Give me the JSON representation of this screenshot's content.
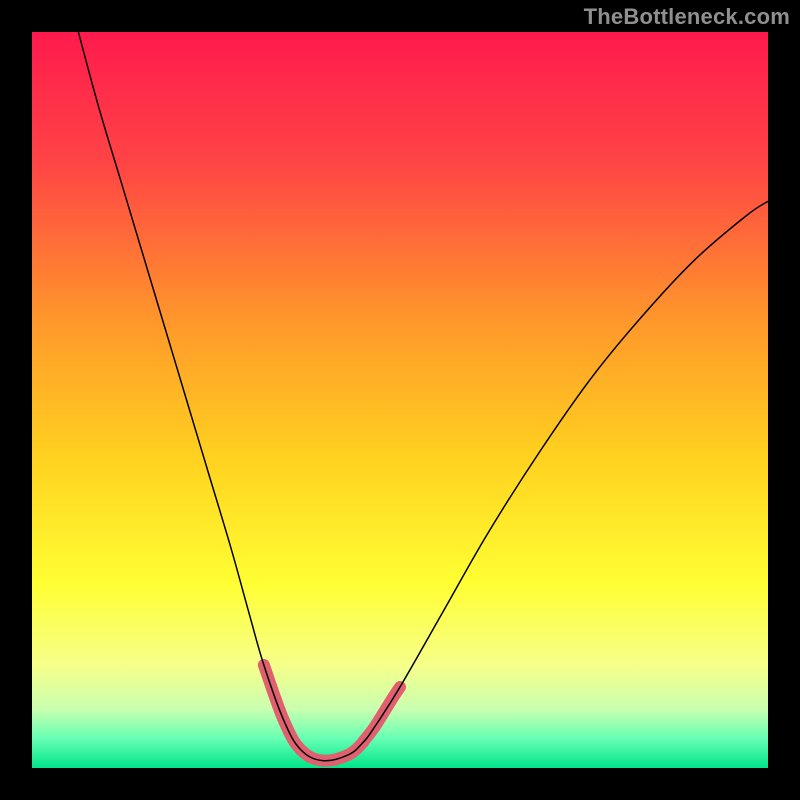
{
  "watermark": "TheBottleneck.com",
  "chart_data": {
    "type": "line",
    "title": "",
    "xlabel": "",
    "ylabel": "",
    "xlim": [
      0,
      1
    ],
    "ylim": [
      0,
      1
    ],
    "legend": false,
    "grid": false,
    "background_gradient": {
      "stops": [
        {
          "t": 0.0,
          "color": "#ff1a4d"
        },
        {
          "t": 0.18,
          "color": "#ff4545"
        },
        {
          "t": 0.4,
          "color": "#ff9a2a"
        },
        {
          "t": 0.58,
          "color": "#ffd21f"
        },
        {
          "t": 0.75,
          "color": "#ffff33"
        },
        {
          "t": 0.86,
          "color": "#f6ff8a"
        },
        {
          "t": 0.92,
          "color": "#c9ffb0"
        },
        {
          "t": 0.96,
          "color": "#66ffb3"
        },
        {
          "t": 1.0,
          "color": "#00e58a"
        }
      ]
    },
    "series": [
      {
        "name": "bottleneck-curve",
        "color": "#000000",
        "width": 1.5,
        "points": [
          {
            "x": 0.063,
            "y": 1.0
          },
          {
            "x": 0.09,
            "y": 0.9
          },
          {
            "x": 0.12,
            "y": 0.8
          },
          {
            "x": 0.15,
            "y": 0.7
          },
          {
            "x": 0.18,
            "y": 0.6
          },
          {
            "x": 0.21,
            "y": 0.5
          },
          {
            "x": 0.24,
            "y": 0.4
          },
          {
            "x": 0.27,
            "y": 0.3
          },
          {
            "x": 0.295,
            "y": 0.21
          },
          {
            "x": 0.315,
            "y": 0.14
          },
          {
            "x": 0.342,
            "y": 0.065
          },
          {
            "x": 0.365,
            "y": 0.025
          },
          {
            "x": 0.395,
            "y": 0.01
          },
          {
            "x": 0.43,
            "y": 0.018
          },
          {
            "x": 0.45,
            "y": 0.035
          },
          {
            "x": 0.465,
            "y": 0.055
          },
          {
            "x": 0.5,
            "y": 0.11
          },
          {
            "x": 0.56,
            "y": 0.215
          },
          {
            "x": 0.62,
            "y": 0.32
          },
          {
            "x": 0.69,
            "y": 0.43
          },
          {
            "x": 0.76,
            "y": 0.53
          },
          {
            "x": 0.83,
            "y": 0.615
          },
          {
            "x": 0.9,
            "y": 0.69
          },
          {
            "x": 0.97,
            "y": 0.75
          },
          {
            "x": 1.0,
            "y": 0.77
          }
        ]
      },
      {
        "name": "highlight-left",
        "color": "#e06070",
        "width": 12,
        "linecap": "round",
        "points": [
          {
            "x": 0.315,
            "y": 0.14
          },
          {
            "x": 0.342,
            "y": 0.065
          },
          {
            "x": 0.365,
            "y": 0.025
          },
          {
            "x": 0.395,
            "y": 0.01
          },
          {
            "x": 0.43,
            "y": 0.018
          },
          {
            "x": 0.45,
            "y": 0.035
          }
        ]
      },
      {
        "name": "highlight-right",
        "color": "#e06070",
        "width": 12,
        "linecap": "round",
        "points": [
          {
            "x": 0.45,
            "y": 0.036
          },
          {
            "x": 0.465,
            "y": 0.055
          },
          {
            "x": 0.49,
            "y": 0.095
          },
          {
            "x": 0.5,
            "y": 0.11
          }
        ]
      }
    ]
  }
}
